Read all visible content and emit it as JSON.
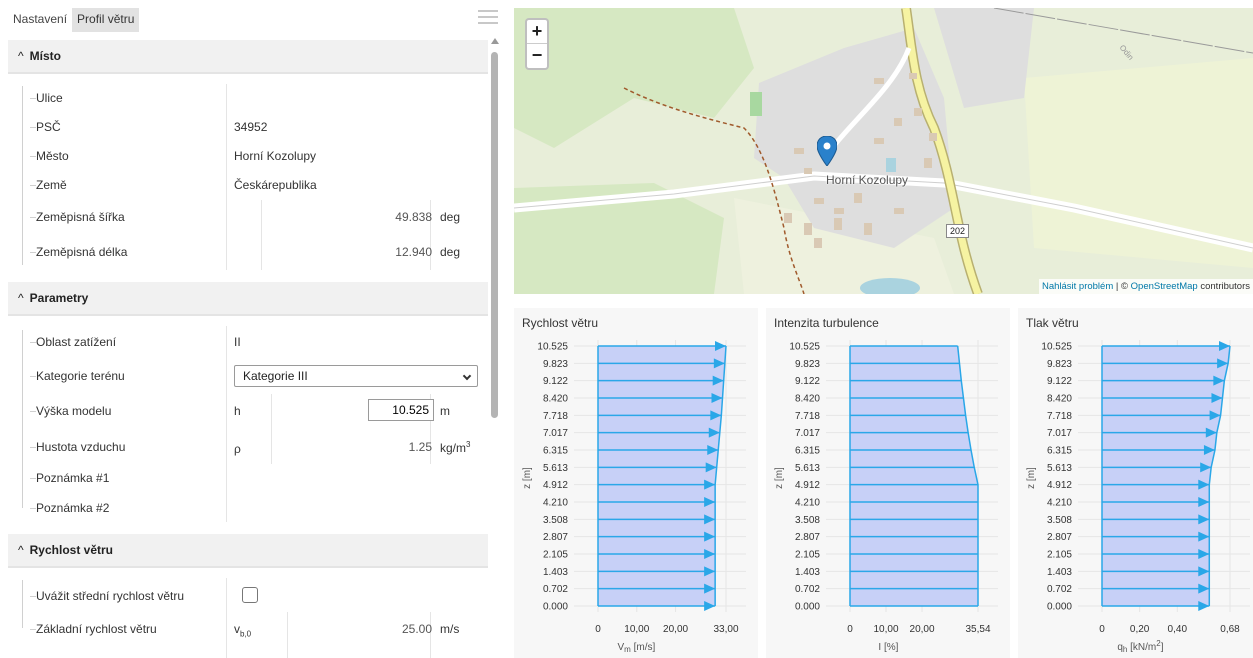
{
  "tabs": [
    {
      "label": "Nastavení",
      "active": false
    },
    {
      "label": "Profil větru",
      "active": true
    }
  ],
  "sections": {
    "misto": {
      "title": "Místo"
    },
    "parametry": {
      "title": "Parametry"
    },
    "rychlost": {
      "title": "Rychlost větru"
    }
  },
  "misto": {
    "ulice": {
      "label": "Ulice",
      "value": ""
    },
    "psc": {
      "label": "PSČ",
      "value": "34952"
    },
    "mesto": {
      "label": "Město",
      "value": "Horní Kozolupy"
    },
    "zeme": {
      "label": "Země",
      "value": "Českárepublika"
    },
    "lat": {
      "label": "Zeměpisná šířka",
      "value": "49.838",
      "unit": "deg"
    },
    "lon": {
      "label": "Zeměpisná délka",
      "value": "12.940",
      "unit": "deg"
    }
  },
  "parametry": {
    "oblast": {
      "label": "Oblast zatížení",
      "value": "II"
    },
    "kategorie": {
      "label": "Kategorie terénu",
      "value": "Kategorie III"
    },
    "vyska": {
      "label": "Výška modelu",
      "symbol": "h",
      "value": "10.525",
      "unit": "m"
    },
    "hustota": {
      "label": "Hustota vzduchu",
      "symbol": "ρ",
      "value": "1.25",
      "unit_base": "kg/m",
      "unit_sup": "3"
    },
    "poznamka1": {
      "label": "Poznámka #1"
    },
    "poznamka2": {
      "label": "Poznámka #2"
    }
  },
  "rychlost": {
    "stredni": {
      "label": "Uvážit střední rychlost větru",
      "checked": false
    },
    "zakladni": {
      "label": "Základní rychlost větru",
      "symbol_base": "v",
      "symbol_sub": "b,0",
      "value": "25.00",
      "unit": "m/s"
    }
  },
  "map": {
    "town": "Horní Kozolupy",
    "road_number": "202",
    "area_label": "Odin",
    "zoom_in": "+",
    "zoom_out": "−",
    "attribution_link1": "Nahlásit problém",
    "attribution_sep": " | © ",
    "attribution_link2": "OpenStreetMap",
    "attribution_tail": " contributors",
    "colors": {
      "land": "#e6ecd6",
      "forest": "#d4e6c0",
      "residential": "#e0e0e0",
      "main_road": "#f6f3a2",
      "building": "#d9c9b4",
      "marker": "#2a81cb"
    }
  },
  "chart_data": [
    {
      "type": "bar",
      "orientation": "horizontal",
      "title": "Rychlost větru",
      "ylabel": "z [m]",
      "xlabel_base": "V",
      "xlabel_sub": "m",
      "xlabel_tail": " [m/s]",
      "yticks": [
        "0.000",
        "0.702",
        "1.403",
        "2.105",
        "2.807",
        "3.508",
        "4.210",
        "4.912",
        "5.613",
        "6.315",
        "7.017",
        "7.718",
        "8.420",
        "9.122",
        "9.823",
        "10.525"
      ],
      "xticks": [
        "0",
        "10,00",
        "20,00",
        "33,00"
      ],
      "xlim": [
        0,
        33
      ],
      "y": [
        0,
        0.702,
        1.403,
        2.105,
        2.807,
        3.508,
        4.21,
        4.912,
        5.613,
        6.315,
        7.017,
        7.718,
        8.42,
        9.122,
        9.823,
        10.525
      ],
      "values": [
        30.2,
        30.2,
        30.2,
        30.2,
        30.2,
        30.2,
        30.2,
        30.2,
        30.6,
        31.0,
        31.4,
        31.8,
        32.1,
        32.4,
        32.7,
        33.0
      ],
      "color": "#2aa7e8",
      "fill": "#c7d0f7"
    },
    {
      "type": "bar",
      "orientation": "horizontal",
      "title": "Intenzita turbulence",
      "ylabel": "z [m]",
      "xlabel_base": "I [%]",
      "xlabel_sub": "",
      "xlabel_tail": "",
      "yticks": [
        "0.000",
        "0.702",
        "1.403",
        "2.105",
        "2.807",
        "3.508",
        "4.210",
        "4.912",
        "5.613",
        "6.315",
        "7.017",
        "7.718",
        "8.420",
        "9.122",
        "9.823",
        "10.525"
      ],
      "xticks": [
        "0",
        "10,00",
        "20,00",
        "35,54"
      ],
      "xlim": [
        0,
        35.54
      ],
      "y": [
        0,
        0.702,
        1.403,
        2.105,
        2.807,
        3.508,
        4.21,
        4.912,
        5.613,
        6.315,
        7.017,
        7.718,
        8.42,
        9.122,
        9.823,
        10.525
      ],
      "values": [
        35.54,
        35.54,
        35.54,
        35.54,
        35.54,
        35.54,
        35.54,
        35.54,
        34.5,
        33.6,
        32.8,
        32.1,
        31.5,
        30.9,
        30.4,
        29.9
      ],
      "color": "#2aa7e8",
      "fill": "#c7d0f7"
    },
    {
      "type": "bar",
      "orientation": "horizontal",
      "title": "Tlak větru",
      "ylabel": "z [m]",
      "xlabel_base": "q",
      "xlabel_sub": "h",
      "xlabel_tail": " [kN/m",
      "xlabel_sup": "2",
      "xlabel_end": "]",
      "yticks": [
        "0.000",
        "0.702",
        "1.403",
        "2.105",
        "2.807",
        "3.508",
        "4.210",
        "4.912",
        "5.613",
        "6.315",
        "7.017",
        "7.718",
        "8.420",
        "9.122",
        "9.823",
        "10.525"
      ],
      "xticks": [
        "0",
        "0,20",
        "0,40",
        "0,68"
      ],
      "xlim": [
        0,
        0.68
      ],
      "y": [
        0,
        0.702,
        1.403,
        2.105,
        2.807,
        3.508,
        4.21,
        4.912,
        5.613,
        6.315,
        7.017,
        7.718,
        8.42,
        9.122,
        9.823,
        10.525
      ],
      "values": [
        0.57,
        0.57,
        0.57,
        0.57,
        0.57,
        0.57,
        0.57,
        0.57,
        0.58,
        0.6,
        0.61,
        0.63,
        0.64,
        0.65,
        0.67,
        0.68
      ],
      "color": "#2aa7e8",
      "fill": "#c7d0f7"
    }
  ]
}
